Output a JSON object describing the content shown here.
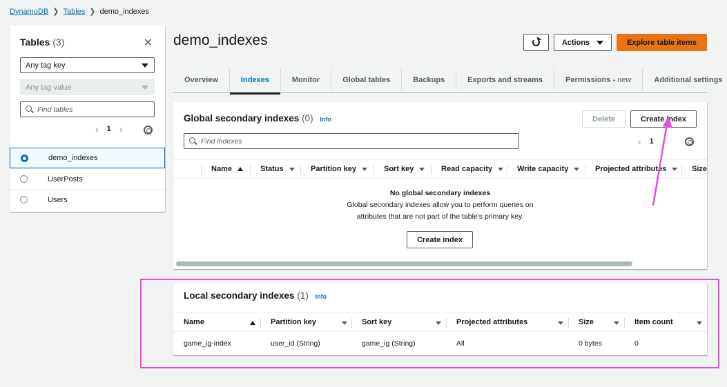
{
  "breadcrumb": {
    "root": "DynamoDB",
    "tables": "Tables",
    "current": "demo_indexes"
  },
  "sidebar": {
    "title": "Tables",
    "count": "(3)",
    "tag_key": "Any tag key",
    "tag_value": "Any tag value",
    "search_placeholder": "Find tables",
    "page": "1",
    "tables": [
      {
        "name": "demo_indexes",
        "selected": true
      },
      {
        "name": "UserPosts",
        "selected": false
      },
      {
        "name": "Users",
        "selected": false
      }
    ]
  },
  "header": {
    "title": "demo_indexes",
    "actions_label": "Actions",
    "explore_label": "Explore table items"
  },
  "tabs": [
    {
      "label": "Overview"
    },
    {
      "label": "Indexes"
    },
    {
      "label": "Monitor"
    },
    {
      "label": "Global tables"
    },
    {
      "label": "Backups"
    },
    {
      "label": "Exports and streams"
    },
    {
      "label": "Permissions - ",
      "suffix": "new"
    },
    {
      "label": "Additional settings"
    }
  ],
  "gsi": {
    "title": "Global secondary indexes",
    "count": "(0)",
    "info": "Info",
    "delete_label": "Delete",
    "create_label": "Create index",
    "search_placeholder": "Find indexes",
    "page": "1",
    "columns": [
      "Name",
      "Status",
      "Partition key",
      "Sort key",
      "Read capacity",
      "Write capacity",
      "Projected attributes",
      "Size"
    ],
    "empty_title": "No global secondary indexes",
    "empty_line1": "Global secondary indexes allow you to perform queries on",
    "empty_line2": "attributes that are not part of the table's primary key.",
    "empty_button": "Create index"
  },
  "lsi": {
    "title": "Local secondary indexes",
    "count": "(1)",
    "info": "Info",
    "columns": [
      "Name",
      "Partition key",
      "Sort key",
      "Projected attributes",
      "Size",
      "Item count"
    ],
    "row": {
      "name": "game_ig-index",
      "partition_key": "user_id (String)",
      "sort_key": "game_ig (String)",
      "projected": "All",
      "size": "0 bytes",
      "item_count": "0"
    }
  },
  "colors": {
    "accent": "#0073bb",
    "primary_button": "#ec7211",
    "annotation": "#e64ae6"
  }
}
